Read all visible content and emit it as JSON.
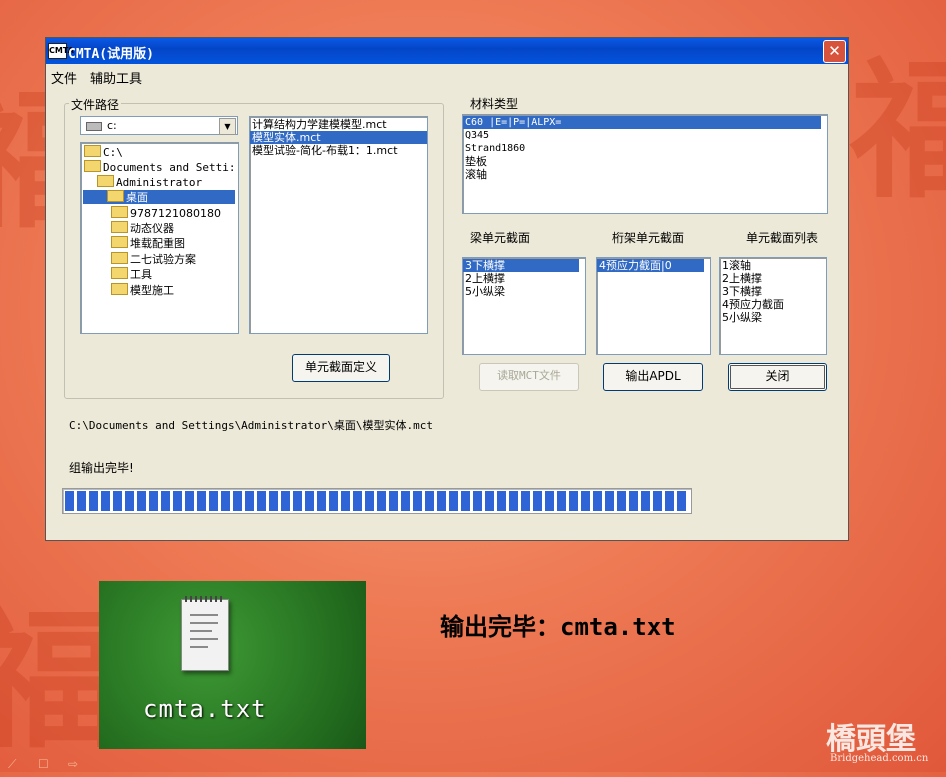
{
  "window": {
    "title": "CMTA(试用版)",
    "icon_text": "CMTA",
    "close_glyph": "✕"
  },
  "menu": [
    "文件",
    "辅助工具"
  ],
  "file_path_group": {
    "label": "文件路径",
    "drive_value": "c:",
    "tree": [
      "C:\\",
      "Documents and Setti:",
      "Administrator",
      "桌面",
      "9787121080180",
      "动态仪器",
      "堆载配重图",
      "二七试验方案",
      "工具",
      "模型施工"
    ],
    "files": [
      "计算结构力学建模模型.mct",
      "模型实体.mct",
      "模型试验-简化-布载1：1.mct"
    ],
    "section_define_button": "单元截面定义"
  },
  "material": {
    "label": "材料类型",
    "items": [
      "C60  |E=|P=|ALPX=",
      "Q345",
      "Strand1860",
      "垫板",
      "滚轴"
    ]
  },
  "beam_section": {
    "label": "梁单元截面",
    "items": [
      "3下横撑",
      "2上横撑",
      "5小纵梁"
    ]
  },
  "truss_section": {
    "label": "桁架单元截面",
    "items": [
      "4预应力截面|0"
    ]
  },
  "section_list": {
    "label": "单元截面列表",
    "items": [
      "1滚轴",
      "2上横撑",
      "3下横撑",
      "4预应力截面",
      "5小纵梁"
    ]
  },
  "buttons": {
    "read_mct": "读取MCT文件",
    "export_apdl": "输出APDL",
    "close": "关闭"
  },
  "current_path": "C:\\Documents and Settings\\Administrator\\桌面\\模型实体.mct",
  "status": "组输出完毕!",
  "progress": 1.0,
  "desktop_file": {
    "name": "cmta.txt"
  },
  "output_message": "输出完毕：cmta.txt",
  "watermark": {
    "name": "橋頭堡",
    "url": "Bridgehead.com.cn"
  },
  "nav": [
    "⟋",
    "☐",
    "⇨"
  ]
}
